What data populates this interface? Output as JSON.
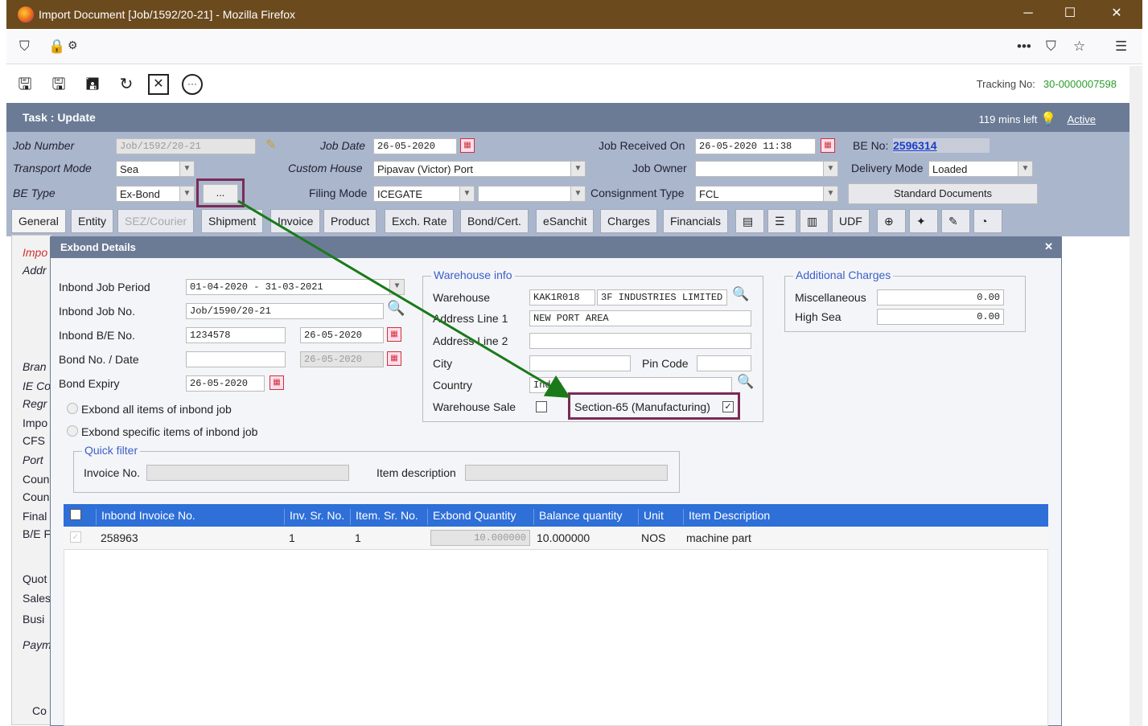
{
  "window": {
    "title": "Import Document [Job/1592/20-21] - Mozilla Firefox",
    "minimize": "─",
    "maximize": "☐",
    "close": "✕"
  },
  "toolbar": {
    "tracking_label": "Tracking No:",
    "tracking_value": "30-0000007598"
  },
  "task": {
    "label": "Task : Update",
    "time_left": "119 mins left",
    "status": "Active"
  },
  "form": {
    "job_number_label": "Job Number",
    "job_number": "Job/1592/20-21",
    "job_date_label": "Job Date",
    "job_date": "26-05-2020",
    "job_received_label": "Job Received On",
    "job_received": "26-05-2020 11:38",
    "be_no_label": "BE No:",
    "be_no": "2596314",
    "transport_mode_label": "Transport Mode",
    "transport_mode": "Sea",
    "custom_house_label": "Custom House",
    "custom_house": "Pipavav (Victor) Port",
    "job_owner_label": "Job Owner",
    "job_owner": "",
    "delivery_mode_label": "Delivery Mode",
    "delivery_mode": "Loaded",
    "be_type_label": "BE Type",
    "be_type": "Ex-Bond",
    "more_btn": "...",
    "filing_mode_label": "Filing Mode",
    "filing_mode": "ICEGATE",
    "consignment_label": "Consignment Type",
    "consignment": "FCL",
    "std_docs": "Standard Documents"
  },
  "tabs": [
    "General",
    "Entity",
    "SEZ/Courier",
    "Shipment",
    "Invoice",
    "Product",
    "Exch. Rate",
    "Bond/Cert.",
    "eSanchit",
    "Charges",
    "Financials",
    "UDF"
  ],
  "left_panel": [
    "Impo",
    "Addr",
    "Bran",
    "IE Co",
    "Regr",
    "Impo",
    "CFS",
    "Port",
    "Coun",
    "Coun",
    "Final",
    "B/E F",
    "Quot",
    "Sales",
    "Busi",
    "Paym",
    "Co"
  ],
  "dialog": {
    "title": "Exbond Details",
    "inbond_period_label": "Inbond Job Period",
    "inbond_period": "01-04-2020 - 31-03-2021",
    "inbond_job_label": "Inbond Job No.",
    "inbond_job": "Job/1590/20-21",
    "inbond_be_label": "Inbond B/E No.",
    "inbond_be": "1234578",
    "inbond_be_date": "26-05-2020",
    "bond_label": "Bond No. / Date",
    "bond_no": "",
    "bond_date": "26-05-2020",
    "bond_expiry_label": "Bond Expiry",
    "bond_expiry": "26-05-2020",
    "radio_all": "Exbond all items of inbond job",
    "radio_specific": "Exbond specific items of inbond job",
    "quick_filter": "Quick filter",
    "invoice_no_label": "Invoice No.",
    "item_desc_label": "Item description",
    "warehouse_info": "Warehouse info",
    "warehouse_label": "Warehouse",
    "warehouse_code": "KAK1R018",
    "warehouse_name": "3F INDUSTRIES LIMITED",
    "addr1_label": "Address Line 1",
    "addr1": "NEW PORT AREA",
    "addr2_label": "Address Line 2",
    "addr2": "",
    "city_label": "City",
    "city": "",
    "pin_label": "Pin Code",
    "pin": "",
    "country_label": "Country",
    "country": "India",
    "wh_sale_label": "Warehouse Sale",
    "section65_label": "Section-65 (Manufacturing)",
    "add_charges": "Additional Charges",
    "misc_label": "Miscellaneous",
    "misc": "0.00",
    "high_sea_label": "High Sea",
    "high_sea": "0.00",
    "grid_headers": [
      "Inbond Invoice No.",
      "Inv. Sr. No.",
      "Item. Sr. No.",
      "Exbond Quantity",
      "Balance quantity",
      "Unit",
      "Item Description"
    ],
    "grid_row": {
      "invoice": "258963",
      "inv_sr": "1",
      "item_sr": "1",
      "exbond_qty": "10.000000",
      "balance": "10.000000",
      "unit": "NOS",
      "desc": "machine part"
    }
  }
}
